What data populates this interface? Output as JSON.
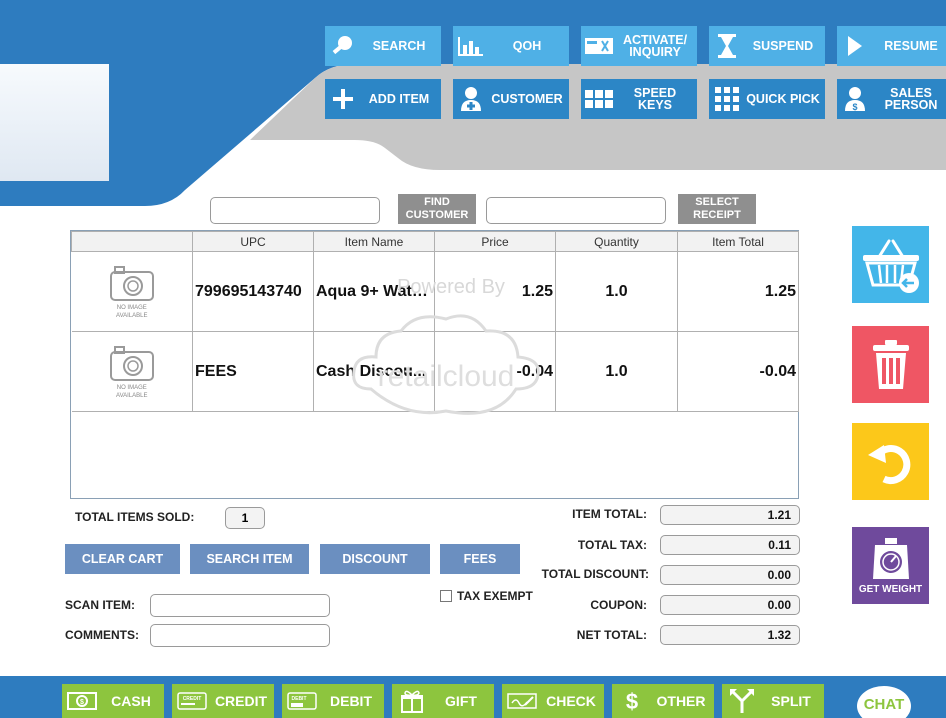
{
  "toolbar": {
    "row1": [
      {
        "label": "SEARCH",
        "icon": "magnifier-icon"
      },
      {
        "label": "QOH",
        "icon": "bar-chart-icon"
      },
      {
        "label": "ACTIVATE/\nINQUIRY",
        "icon": "card-activate-icon"
      },
      {
        "label": "SUSPEND",
        "icon": "hourglass-icon"
      },
      {
        "label": "RESUME",
        "icon": "play-icon"
      }
    ],
    "row2": [
      {
        "label": "ADD ITEM",
        "icon": "plus-icon"
      },
      {
        "label": "CUSTOMER",
        "icon": "add-customer-icon"
      },
      {
        "label": "SPEED KEYS",
        "icon": "speed-keys-icon"
      },
      {
        "label": "QUICK PICK",
        "icon": "grid-dots-icon"
      },
      {
        "label": "SALES\nPERSON",
        "icon": "salesperson-icon"
      }
    ]
  },
  "customer": {
    "find_label": "FIND\nCUSTOMER",
    "select_receipt_label": "SELECT\nRECEIPT",
    "customer_value": "",
    "receipt_value": ""
  },
  "cart": {
    "columns": [
      "",
      "UPC",
      "Item Name",
      "Price",
      "Quantity",
      "Item Total"
    ],
    "no_image_caption": "NO IMAGE\nAVAILABLE",
    "rows": [
      {
        "upc": "799695143740",
        "name": "Aqua 9+ Wate...",
        "price": "1.25",
        "quantity": "1.0",
        "total": "1.25"
      },
      {
        "upc": "FEES",
        "name": "Cash Discou...",
        "price": "-0.04",
        "quantity": "1.0",
        "total": "-0.04"
      }
    ],
    "watermark_top": "Powered By",
    "watermark_brand": "retailcloud"
  },
  "summary": {
    "total_items_label": "TOTAL ITEMS SOLD:",
    "total_items_value": "1",
    "item_total_label": "ITEM TOTAL:",
    "item_total": "1.21",
    "total_tax_label": "TOTAL TAX:",
    "total_tax": "0.11",
    "total_discount_label": "TOTAL DISCOUNT:",
    "total_discount": "0.00",
    "coupon_label": "COUPON:",
    "coupon": "0.00",
    "net_total_label": "NET TOTAL:",
    "net_total": "1.32"
  },
  "actions": {
    "clear_cart": "CLEAR CART",
    "search_item": "SEARCH ITEM",
    "discount": "DISCOUNT",
    "fees": "FEES",
    "tax_exempt": "TAX EXEMPT",
    "scan_item_label": "SCAN ITEM:",
    "comments_label": "COMMENTS:",
    "scan_item_value": "",
    "comments_value": ""
  },
  "side": {
    "get_weight": "GET WEIGHT"
  },
  "payments": [
    {
      "label": "CASH",
      "icon": "cash-icon",
      "tag": ""
    },
    {
      "label": "CREDIT",
      "icon": "credit-card-icon",
      "tag": "CREDIT"
    },
    {
      "label": "DEBIT",
      "icon": "debit-card-icon",
      "tag": "DEBIT"
    },
    {
      "label": "GIFT",
      "icon": "gift-icon",
      "tag": ""
    },
    {
      "label": "CHECK",
      "icon": "check-icon",
      "tag": ""
    },
    {
      "label": "OTHER",
      "icon": "dollar-icon",
      "tag": ""
    },
    {
      "label": "SPLIT",
      "icon": "split-icon",
      "tag": ""
    }
  ],
  "chat": "CHAT",
  "colors": {
    "header_blue": "#2e7cbf",
    "button_blue": "#2c86c6",
    "button_light_blue": "#4fb0e6",
    "action_blue": "#6b8fc0",
    "pay_green": "#8dc53e",
    "side_cyan": "#43b6e9",
    "side_red": "#ef5664",
    "side_yellow": "#fcc81a",
    "side_purple": "#6f4a9c"
  }
}
